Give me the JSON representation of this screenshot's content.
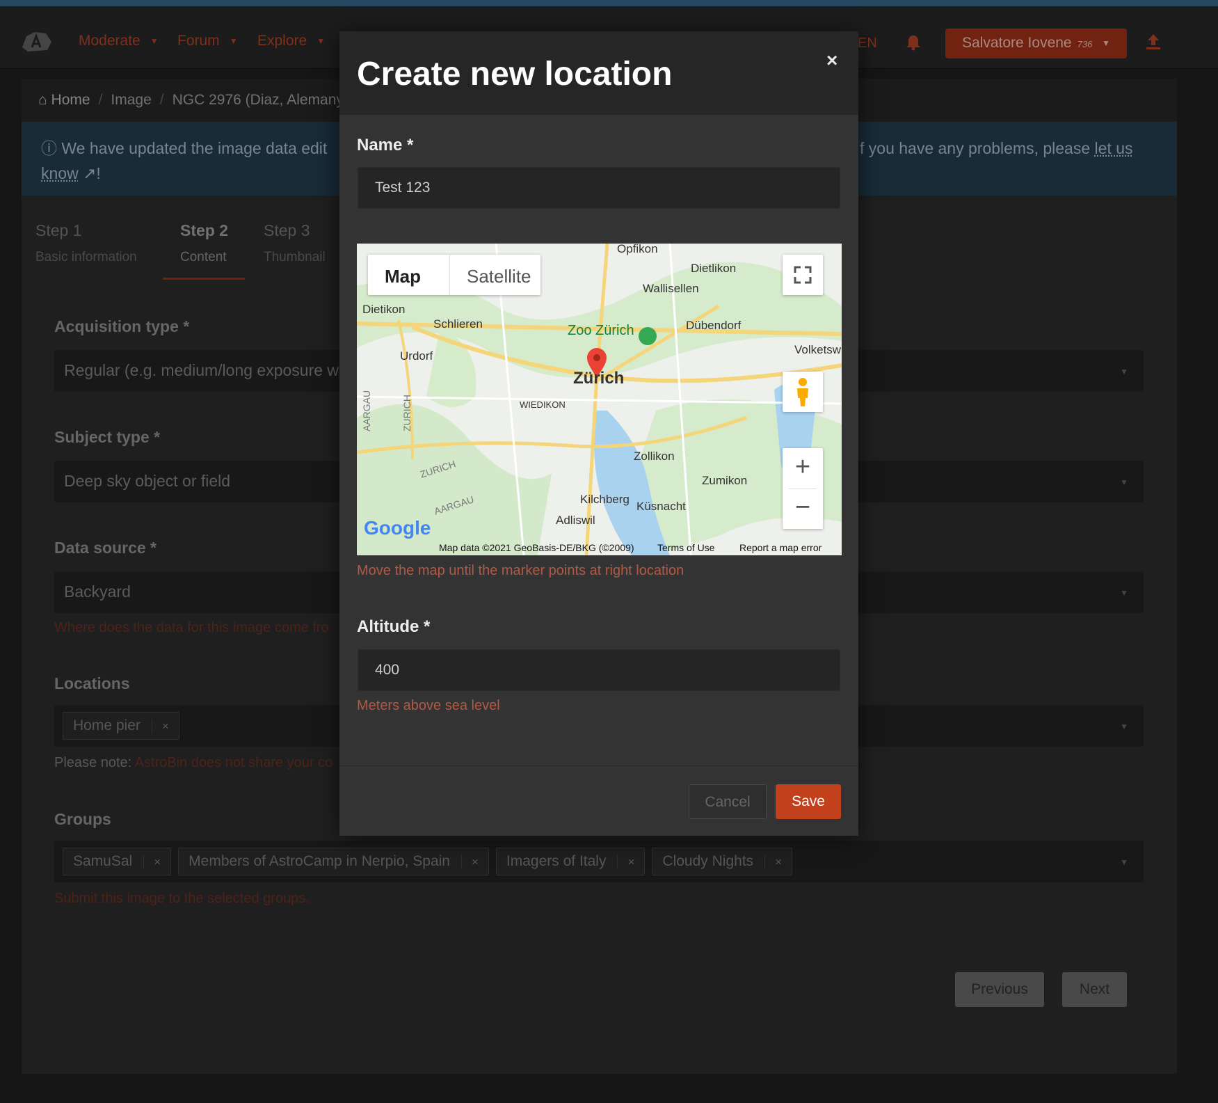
{
  "nav": {
    "items": [
      {
        "label": "Moderate"
      },
      {
        "label": "Forum"
      },
      {
        "label": "Explore"
      }
    ],
    "lang": "EN",
    "user": {
      "name": "Salvatore Iovene",
      "reputation": "736"
    }
  },
  "breadcrumb": {
    "home": "Home",
    "image": "Image",
    "current": "NGC 2976 (Diaz, Alemany"
  },
  "alert": {
    "text_start": "We have updated the image data edit",
    "text_end": "f you have any problems, please",
    "link": "let us",
    "link2": "know",
    "tail": "!"
  },
  "steps": [
    {
      "title": "Step 1",
      "sub": "Basic information"
    },
    {
      "title": "Step 2",
      "sub": "Content"
    },
    {
      "title": "Step 3",
      "sub": "Thumbnail"
    }
  ],
  "form": {
    "acquisition_label": "Acquisition type *",
    "acquisition_value": "Regular (e.g. medium/long exposure w",
    "subject_label": "Subject type *",
    "subject_value": "Deep sky object or field",
    "datasource_label": "Data source *",
    "datasource_value": "Backyard",
    "datasource_help": "Where does the data for this image come fro",
    "locations_label": "Locations",
    "locations_tags": [
      "Home pier"
    ],
    "locations_note_prefix": "Please note:",
    "locations_note": "AstroBin does not share your co",
    "groups_label": "Groups",
    "groups_tags": [
      "SamuSal",
      "Members of AstroCamp in Nerpio, Spain",
      "Imagers of Italy",
      "Cloudy Nights"
    ],
    "groups_help": "Submit this image to the selected groups.",
    "previous": "Previous",
    "next": "Next"
  },
  "modal": {
    "title": "Create new location",
    "close": "×",
    "name_label": "Name *",
    "name_value": "Test 123",
    "map": {
      "type_map": "Map",
      "type_satellite": "Satellite",
      "attribution": "Map data ©2021 GeoBasis-DE/BKG (©2009)",
      "terms": "Terms of Use",
      "report": "Report a map error",
      "google": "Google",
      "places": [
        "Opfikon",
        "Dietlikon",
        "Wallisellen",
        "Dietikon",
        "Schlieren",
        "Zoo Zürich",
        "Dübendorf",
        "Urdorf",
        "Volketsw",
        "Zürich",
        "WIEDIKON",
        "AARGAU",
        "ZURICH",
        "ZURICH",
        "Zollikon",
        "Zumikon",
        "Kilchberg",
        "Küsnacht",
        "Adliswil",
        "AARGAU"
      ]
    },
    "map_help": "Move the map until the marker points at right location",
    "altitude_label": "Altitude *",
    "altitude_value": "400",
    "altitude_help": "Meters above sea level",
    "cancel": "Cancel",
    "save": "Save"
  },
  "colors": {
    "accent": "#c2401c",
    "nav_link": "#9a3b24",
    "alert_bg": "#1e3544"
  }
}
